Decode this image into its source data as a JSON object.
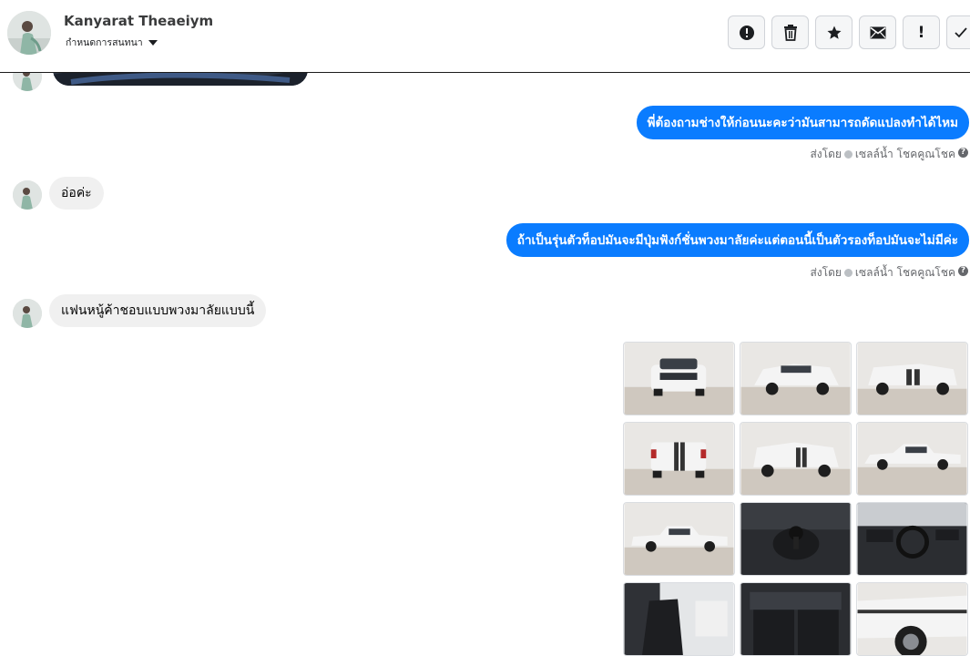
{
  "header": {
    "contact_name": "Kanyarat Theaeiym",
    "subtitle": "กำหนดการสนทนา",
    "toolbar": [
      "alert-circle-icon",
      "trash-icon",
      "star-icon",
      "mail-icon",
      "exclamation-icon",
      "check-icon"
    ],
    "exclamation_label": "!"
  },
  "messages": [
    {
      "direction": "out",
      "text": "พี่ต้องถามช่างให้ก่อนนะคะว่ามันสามารถดัดแปลงทำได้ไหม",
      "sent_by_label": "ส่งโดย",
      "sender": "เซลล์น้ำ โชคคูณโชค"
    },
    {
      "direction": "in",
      "text": "อ่อค่ะ"
    },
    {
      "direction": "out",
      "text": "ถ้าเป็นรุ่นตัวท็อปมันจะมีปุ่มฟังก์ชั่นพวงมาลัยค่ะแต่ตอนนี้เป็นตัวรองท็อปมันจะไม่มีค่ะ",
      "sent_by_label": "ส่งโดย",
      "sender": "เซลล์น้ำ โชคคูณโชค"
    },
    {
      "direction": "in",
      "text": "แฟนหนู้ค้าชอบแบบพวงมาลัยแบบนี้"
    }
  ],
  "help_glyph": "?",
  "photos": [
    "car-front-photo",
    "car-front-left-photo",
    "car-rear-right-photo",
    "car-rear-photo",
    "car-rear-left-photo",
    "car-side-photo",
    "car-side-left-photo",
    "gear-shift-photo",
    "dashboard-photo",
    "front-seat-photo",
    "rear-seat-photo",
    "wheel-detail-photo"
  ],
  "colors": {
    "outgoing_bubble": "#0a7cff",
    "incoming_bubble": "#f0f0f0",
    "meta_text": "#65676b"
  }
}
